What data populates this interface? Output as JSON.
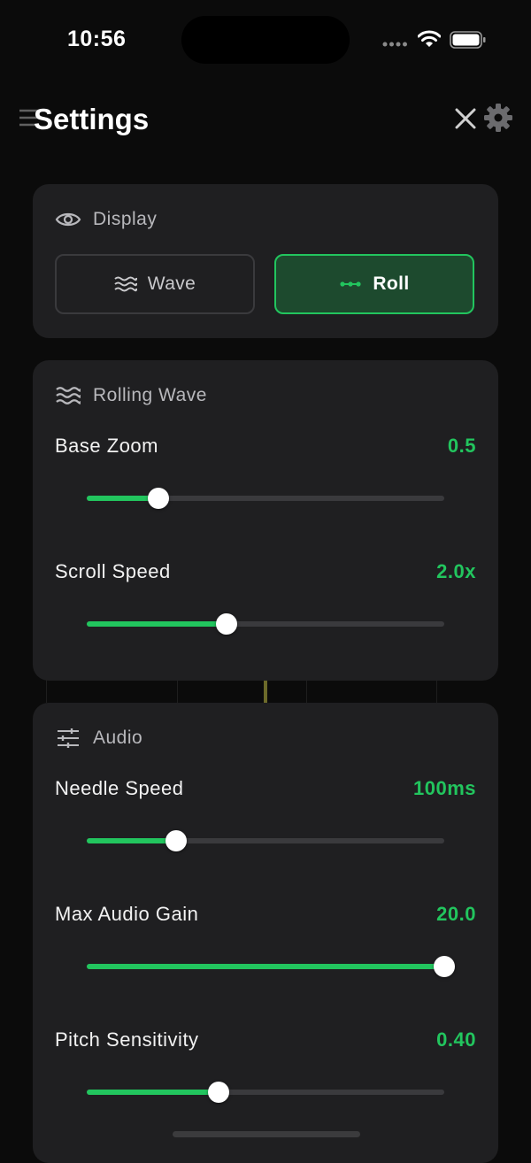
{
  "status_bar": {
    "time": "10:56",
    "icons": [
      "cellular-signal-icon",
      "wifi-icon",
      "battery-icon"
    ]
  },
  "header": {
    "title": "Settings",
    "close_icon": "close-icon",
    "settings_icon": "gear-icon"
  },
  "display": {
    "title": "Display",
    "icon": "eye-icon",
    "options": [
      {
        "label": "Wave",
        "icon": "wave-icon",
        "selected": false
      },
      {
        "label": "Roll",
        "icon": "roll-icon",
        "selected": true
      }
    ]
  },
  "rolling_wave": {
    "title": "Rolling Wave",
    "icon": "wave-icon",
    "settings": [
      {
        "label": "Base Zoom",
        "value": "0.5",
        "fraction": 0.2
      },
      {
        "label": "Scroll Speed",
        "value": "2.0x",
        "fraction": 0.39
      }
    ]
  },
  "audio": {
    "title": "Audio",
    "icon": "sliders-icon",
    "settings": [
      {
        "label": "Needle Speed",
        "value": "100ms",
        "fraction": 0.25
      },
      {
        "label": "Max Audio Gain",
        "value": "20.0",
        "fraction": 1.0
      },
      {
        "label": "Pitch Sensitivity",
        "value": "0.40",
        "fraction": 0.37
      }
    ]
  },
  "colors": {
    "accent": "#22c55e",
    "card_background": "#1f1f21",
    "page_background": "#0b0b0b",
    "selected_background": "#1d4a2e"
  }
}
